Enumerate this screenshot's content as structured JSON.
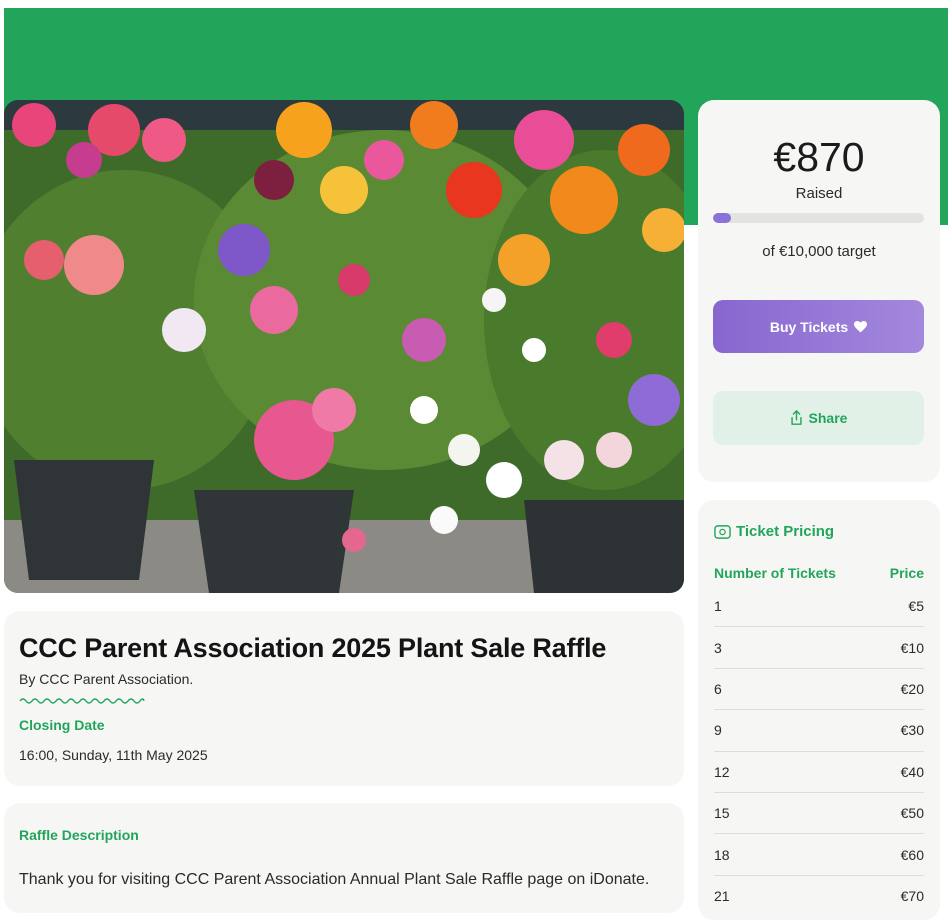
{
  "raffle": {
    "title": "CCC Parent Association 2025 Plant Sale Raffle",
    "by_line": "By CCC Parent Association.",
    "closing_label": "Closing Date",
    "closing_value": "16:00, Sunday, 11th May 2025",
    "description_label": "Raffle Description",
    "description_text": "Thank you for visiting CCC Parent Association Annual Plant Sale Raffle page on iDonate."
  },
  "fundraising": {
    "raised_amount": "€870",
    "raised_label": "Raised",
    "progress_fraction": 0.087,
    "target_label": "of €10,000 target",
    "buy_label": "Buy Tickets",
    "share_label": "Share"
  },
  "pricing": {
    "header": "Ticket Pricing",
    "col_tickets": "Number of Tickets",
    "col_price": "Price",
    "rows": [
      {
        "tickets": "1",
        "price": "€5"
      },
      {
        "tickets": "3",
        "price": "€10"
      },
      {
        "tickets": "6",
        "price": "€20"
      },
      {
        "tickets": "9",
        "price": "€30"
      },
      {
        "tickets": "12",
        "price": "€40"
      },
      {
        "tickets": "15",
        "price": "€50"
      },
      {
        "tickets": "18",
        "price": "€60"
      },
      {
        "tickets": "21",
        "price": "€70"
      }
    ]
  },
  "colors": {
    "brand_green": "#22a55a",
    "accent_purple": "#8767cf",
    "share_bg": "#e2f1e8"
  },
  "icons": {
    "buy": "heart-icon",
    "share": "share-icon",
    "pricing": "ticket-icon"
  }
}
